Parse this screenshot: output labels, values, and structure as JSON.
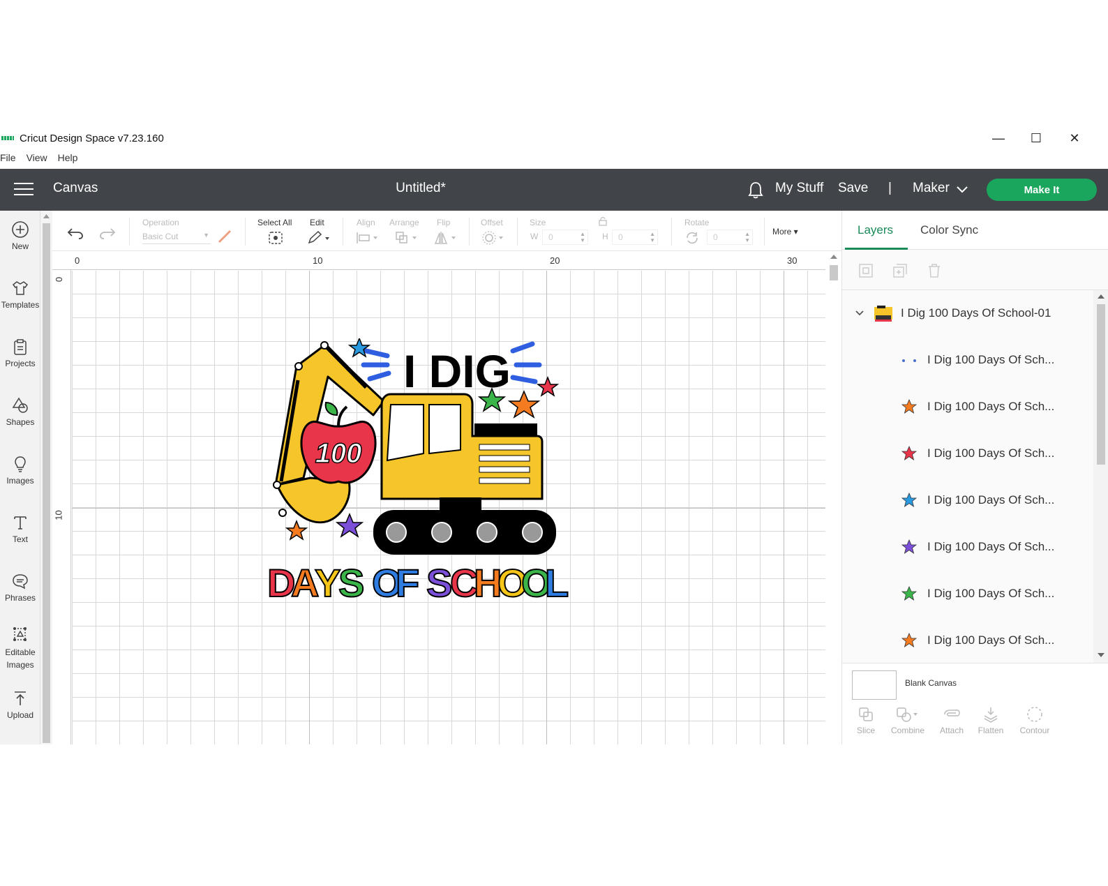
{
  "window": {
    "title": "Cricut Design Space  v7.23.160",
    "controls": [
      "minimize-icon",
      "maximize-icon",
      "close-icon"
    ]
  },
  "menu": [
    "File",
    "View",
    "Help"
  ],
  "header": {
    "section": "Canvas",
    "doc_title": "Untitled*",
    "my_stuff": "My Stuff",
    "save": "Save",
    "divider": "|",
    "machine": "Maker",
    "make_it": "Make It"
  },
  "left_tools": [
    {
      "label": "New",
      "icon": "plus-circle-icon"
    },
    {
      "label": "Templates",
      "icon": "shirt-icon"
    },
    {
      "label": "Projects",
      "icon": "clipboard-icon"
    },
    {
      "label": "Shapes",
      "icon": "shapes-icon"
    },
    {
      "label": "Images",
      "icon": "lightbulb-icon"
    },
    {
      "label": "Text",
      "icon": "text-icon"
    },
    {
      "label": "Phrases",
      "icon": "speech-bubble-icon"
    },
    {
      "label": "Editable\nImages",
      "icon": "editable-image-icon"
    },
    {
      "label": "Upload",
      "icon": "upload-icon"
    }
  ],
  "top_toolbar": {
    "operation_label": "Operation",
    "operation_value": "Basic Cut",
    "select_all": "Select All",
    "edit": "Edit",
    "align": "Align",
    "arrange": "Arrange",
    "flip": "Flip",
    "offset": "Offset",
    "size": "Size",
    "w_label": "W",
    "w_value": "0",
    "h_label": "H",
    "h_value": "0",
    "rotate": "Rotate",
    "rotate_value": "0",
    "more": "More"
  },
  "ruler": {
    "top": [
      "0",
      "10",
      "20",
      "30"
    ],
    "left": [
      "0",
      "10"
    ]
  },
  "design": {
    "headline": "I DIG",
    "number": "100",
    "footer_letters": [
      {
        "ch": "D",
        "color": "#e8354a"
      },
      {
        "ch": "A",
        "color": "#f47b20"
      },
      {
        "ch": "Y",
        "color": "#f5c518"
      },
      {
        "ch": "S",
        "color": "#3bb54a"
      },
      {
        "ch": " ",
        "color": "#000000"
      },
      {
        "ch": "O",
        "color": "#2f7de1"
      },
      {
        "ch": "F",
        "color": "#2f7de1"
      },
      {
        "ch": " ",
        "color": "#000000"
      },
      {
        "ch": "S",
        "color": "#7b4fd8"
      },
      {
        "ch": "C",
        "color": "#e8354a"
      },
      {
        "ch": "H",
        "color": "#f47b20"
      },
      {
        "ch": "O",
        "color": "#f5c518"
      },
      {
        "ch": "O",
        "color": "#3bb54a"
      },
      {
        "ch": "L",
        "color": "#2f7de1"
      }
    ]
  },
  "layers_panel": {
    "tabs": [
      "Layers",
      "Color Sync"
    ],
    "group_name": "I Dig 100 Days Of School-01",
    "layers": [
      {
        "name": "I Dig 100 Days Of Sch...",
        "swatch": "dots",
        "color": "#4a6fd1"
      },
      {
        "name": "I Dig 100 Days Of Sch...",
        "swatch": "star",
        "color": "#f47b20"
      },
      {
        "name": "I Dig 100 Days Of Sch...",
        "swatch": "star",
        "color": "#e8354a"
      },
      {
        "name": "I Dig 100 Days Of Sch...",
        "swatch": "star",
        "color": "#2a9ae0"
      },
      {
        "name": "I Dig 100 Days Of Sch...",
        "swatch": "star",
        "color": "#7b4fd8"
      },
      {
        "name": "I Dig 100 Days Of Sch...",
        "swatch": "star",
        "color": "#3bb54a"
      },
      {
        "name": "I Dig 100 Days Of Sch...",
        "swatch": "star",
        "color": "#f47b20"
      }
    ],
    "blank_canvas": "Blank Canvas",
    "bottom_actions": [
      "Slice",
      "Combine",
      "Attach",
      "Flatten",
      "Contour"
    ]
  },
  "colors": {
    "header_bg": "#414549",
    "accent_green": "#1aa65c",
    "excavator_yellow": "#f5c52a"
  }
}
